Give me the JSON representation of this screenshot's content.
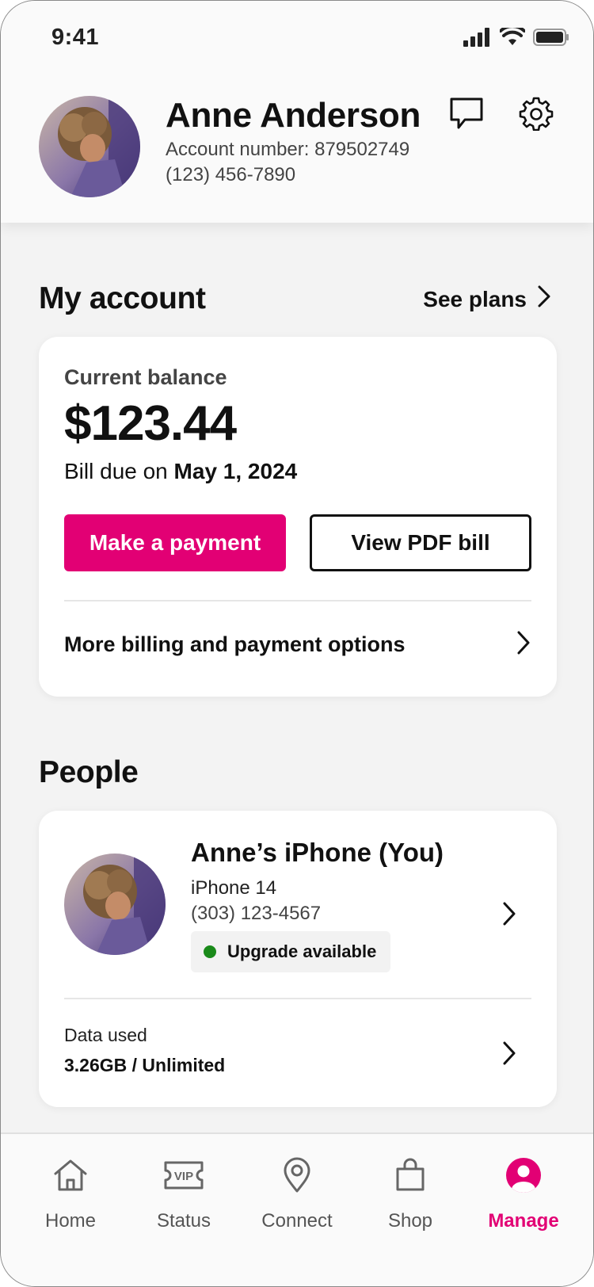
{
  "status_bar": {
    "time": "9:41"
  },
  "profile": {
    "name": "Anne Anderson",
    "account_number": "Account number: 879502749",
    "phone": "(123) 456-7890"
  },
  "my_account": {
    "title": "My account",
    "see_plans": "See plans",
    "balance_label": "Current balance",
    "balance": "$123.44",
    "due_prefix": "Bill due on ",
    "due_date": "May 1, 2024",
    "pay_button": "Make a payment",
    "pdf_button": "View PDF bill",
    "more_options": "More billing and payment options"
  },
  "people": {
    "title": "People",
    "device_name": "Anne’s iPhone (You)",
    "model": "iPhone 14",
    "phone": "(303) 123-4567",
    "badge": "Upgrade available",
    "data_label": "Data used",
    "data_value": "3.26GB / Unlimited"
  },
  "nav": {
    "items": [
      {
        "label": "Home",
        "icon": "home-icon"
      },
      {
        "label": "Status",
        "icon": "vip-icon"
      },
      {
        "label": "Connect",
        "icon": "location-pin-icon"
      },
      {
        "label": "Shop",
        "icon": "shopping-bag-icon"
      },
      {
        "label": "Manage",
        "icon": "account-icon"
      }
    ],
    "active": "Manage"
  },
  "colors": {
    "brand": "#e20074",
    "badge_dot": "#1a8a1a"
  }
}
